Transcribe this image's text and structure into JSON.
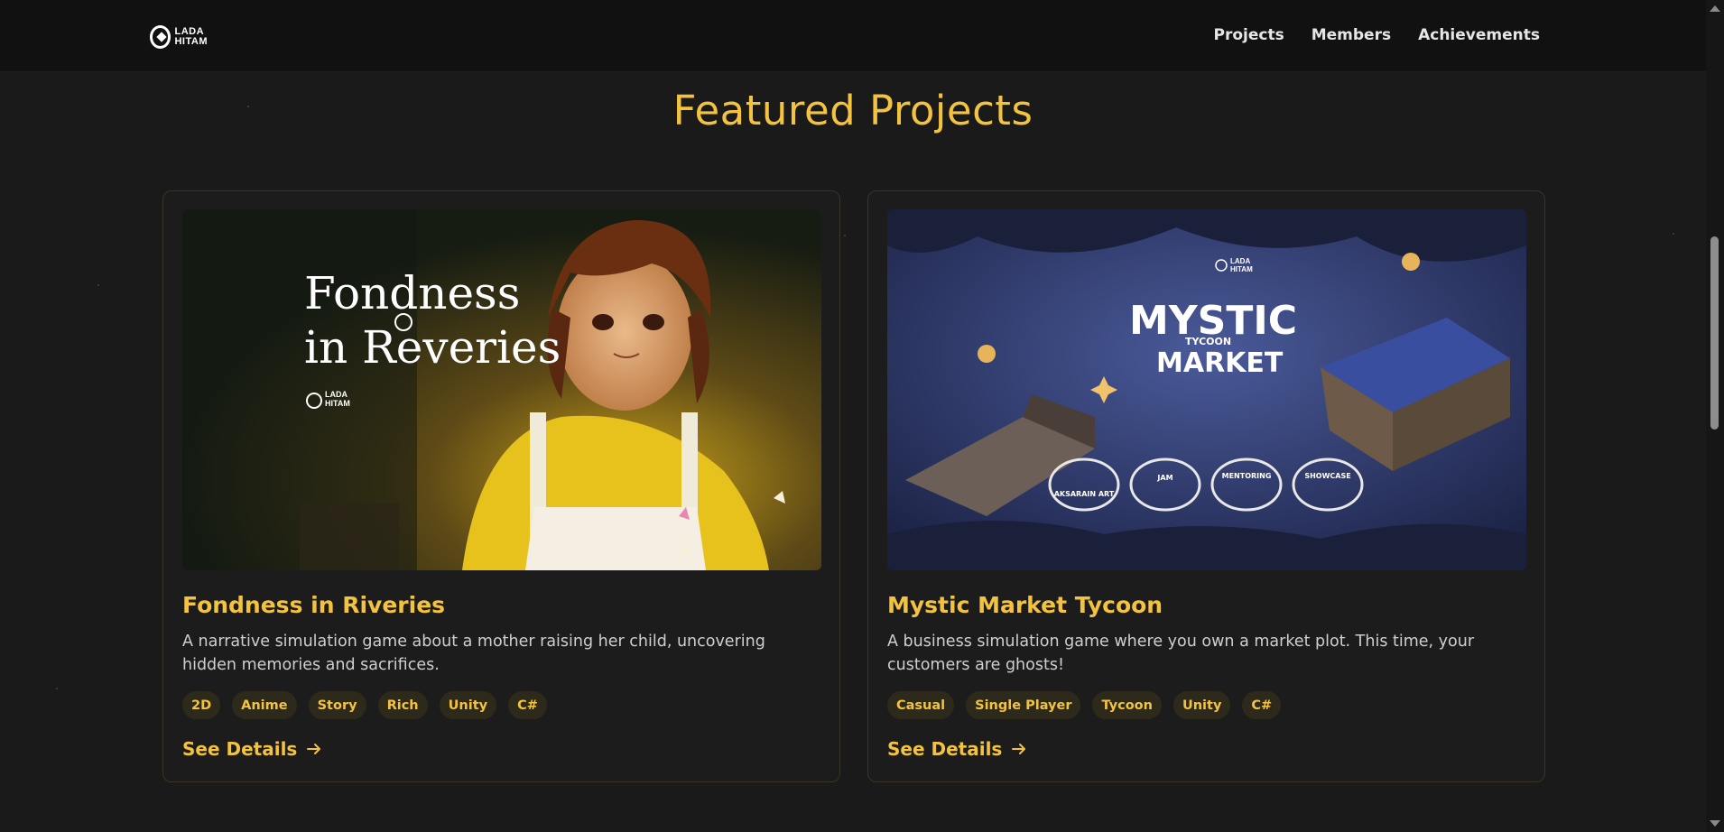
{
  "nav": {
    "logo_line1": "LADA",
    "logo_line2": "HITAM",
    "links": [
      "Projects",
      "Members",
      "Achievements"
    ]
  },
  "page": {
    "title": "Featured Projects"
  },
  "projects": [
    {
      "title": "Fondness in Riveries",
      "description": "A narrative simulation game about a mother raising her child, uncovering hidden memories and sacrifices.",
      "tags": [
        "2D",
        "Anime",
        "Story",
        "Rich",
        "Unity",
        "C#"
      ],
      "cta": "See Details",
      "image_text": {
        "line1": "Fondness",
        "line2": "in Reveries",
        "logo1": "LADA",
        "logo2": "HITAM"
      }
    },
    {
      "title": "Mystic Market Tycoon",
      "description": "A business simulation game where you own a market plot. This time, your customers are ghosts!",
      "tags": [
        "Casual",
        "Single Player",
        "Tycoon",
        "Unity",
        "C#"
      ],
      "cta": "See Details",
      "image_text": {
        "logo1": "LADA",
        "logo2": "HITAM",
        "mystic": "MYSTIC",
        "tycoon": "TYCOON",
        "market": "MARKET",
        "awards": [
          "AKSARAIN ART",
          "JAM",
          "MENTORING",
          "SHOWCASE"
        ]
      }
    }
  ],
  "colors": {
    "accent": "#f3c340",
    "background": "#1a1a1a",
    "navbar": "#111111",
    "tag_bg": "#2e2a1b"
  }
}
